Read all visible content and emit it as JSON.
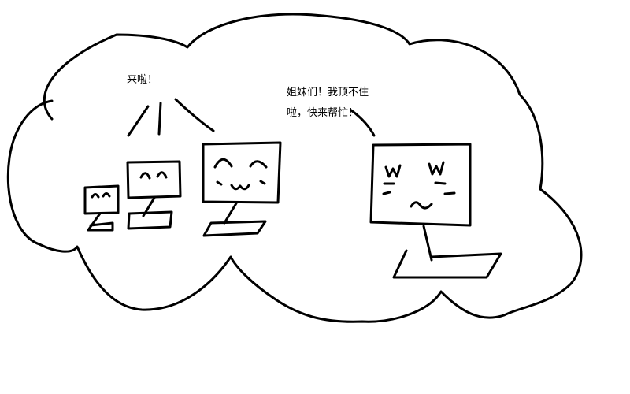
{
  "doodle": {
    "left_caption": "来啦！",
    "right_caption_line1": "姐妹们！我顶不住",
    "right_caption_line2": "啦，快来帮忙！"
  },
  "colors": {
    "ink": "#000000",
    "paper": "#ffffff"
  }
}
